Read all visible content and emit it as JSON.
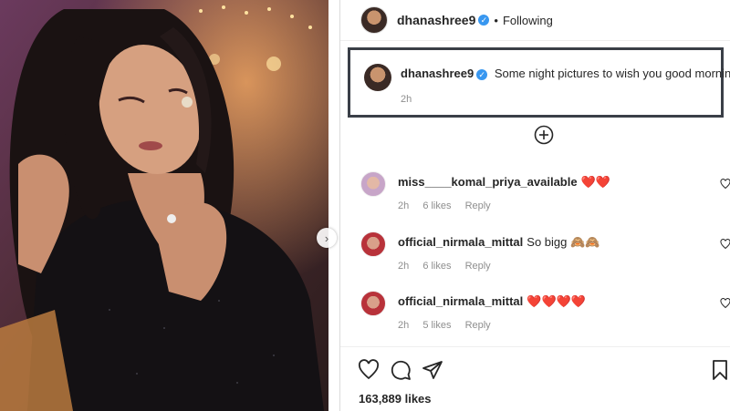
{
  "post": {
    "username": "dhanashree9",
    "follow_status": "Following",
    "separator": "•",
    "likes": "163,889 likes"
  },
  "caption": {
    "username": "dhanashree9",
    "text": "Some night pictures to wish you good morning 🌹",
    "time": "2h"
  },
  "comments": [
    {
      "username": "miss____komal_priya_available",
      "text": "❤️❤️",
      "time": "2h",
      "likes": "6 likes",
      "reply": "Reply"
    },
    {
      "username": "official_nirmala_mittal",
      "text": "So bigg 🙈🙈",
      "time": "2h",
      "likes": "6 likes",
      "reply": "Reply"
    },
    {
      "username": "official_nirmala_mittal",
      "text": "❤️❤️❤️❤️",
      "time": "2h",
      "likes": "5 likes",
      "reply": "Reply"
    }
  ],
  "icons": {
    "verified": "verified-badge-icon",
    "load_more": "plus-circle-icon",
    "like": "heart-icon",
    "comment": "comment-bubble-icon",
    "share": "paper-plane-icon",
    "save": "bookmark-icon",
    "carousel": "chevron-right-icon"
  },
  "colors": {
    "verified": "#3897f0",
    "meta_text": "#8e8e8e",
    "heart_emoji": "#ed1c24",
    "caption_border": "#3a3f47"
  }
}
